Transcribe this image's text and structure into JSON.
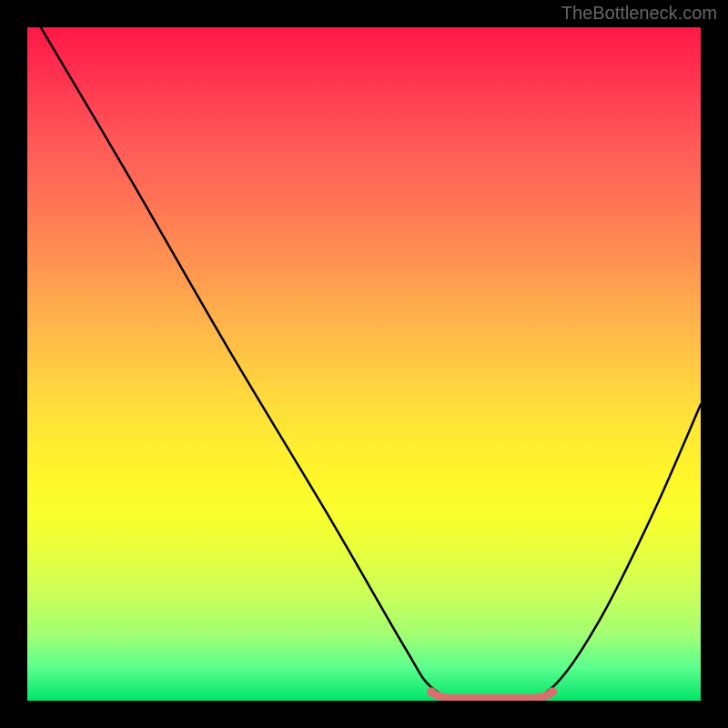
{
  "watermark": "TheBottleneck.com",
  "chart_data": {
    "type": "line",
    "title": "",
    "xlabel": "",
    "ylabel": "",
    "xlim": [
      0,
      100
    ],
    "ylim": [
      0,
      100
    ],
    "curve": {
      "points": [
        {
          "x": 2,
          "y": 100
        },
        {
          "x": 15,
          "y": 78
        },
        {
          "x": 30,
          "y": 52
        },
        {
          "x": 45,
          "y": 27
        },
        {
          "x": 56,
          "y": 8
        },
        {
          "x": 60,
          "y": 2
        },
        {
          "x": 65,
          "y": 0
        },
        {
          "x": 72,
          "y": 0
        },
        {
          "x": 78,
          "y": 2
        },
        {
          "x": 85,
          "y": 12
        },
        {
          "x": 93,
          "y": 28
        },
        {
          "x": 100,
          "y": 44
        }
      ]
    },
    "highlight_band": {
      "start_x": 60,
      "end_x": 78,
      "y": 0.5,
      "color": "#cc6b6b"
    },
    "gradient_stops": [
      {
        "pos": 0,
        "color": "#ff1846"
      },
      {
        "pos": 50,
        "color": "#ffd040"
      },
      {
        "pos": 100,
        "color": "#00e56a"
      }
    ]
  }
}
